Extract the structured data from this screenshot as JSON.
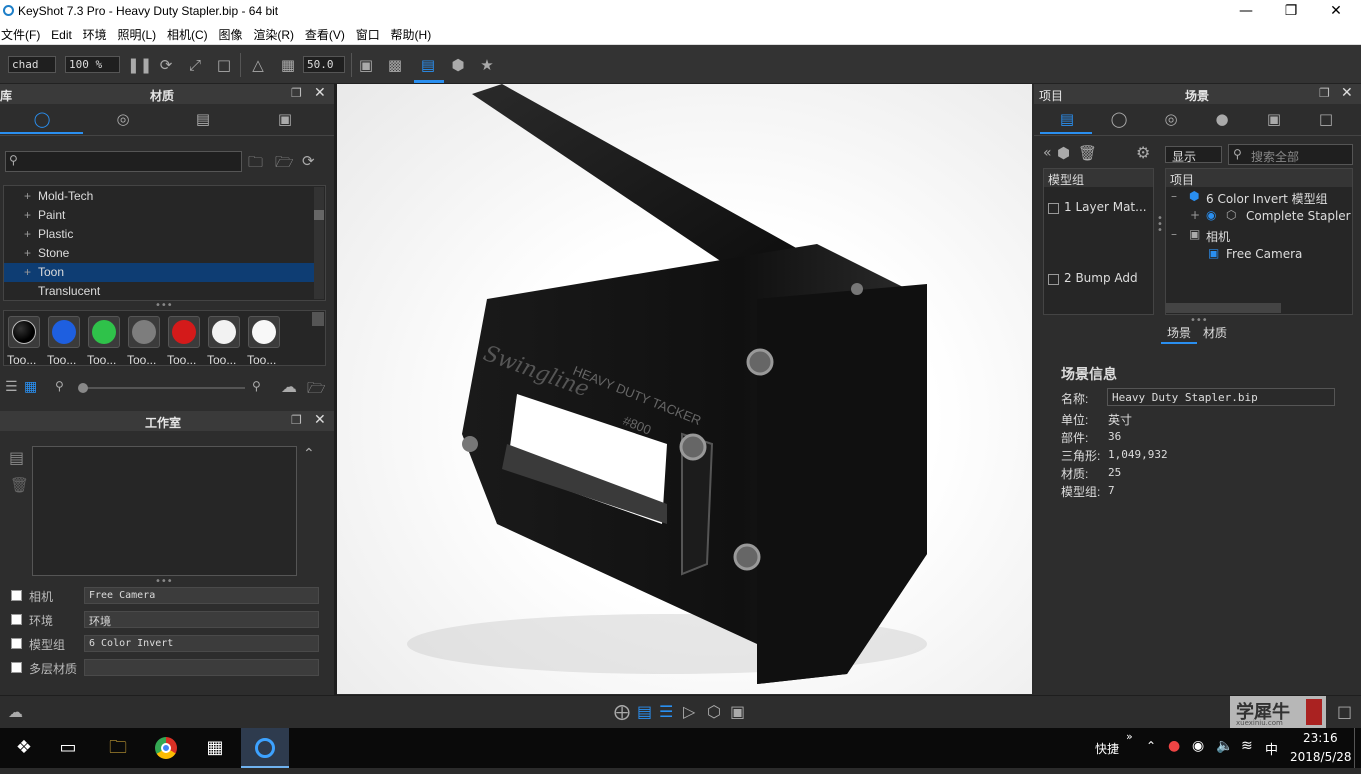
{
  "window": {
    "title": "KeyShot 7.3 Pro  - Heavy Duty Stapler.bip  - 64 bit"
  },
  "menu": [
    "文件(F)",
    "Edit",
    "环境",
    "照明(L)",
    "相机(C)",
    "图像",
    "渲染(R)",
    "查看(V)",
    "窗口",
    "帮助(H)"
  ],
  "toolbar": {
    "cpu_preset": "chad",
    "zoom": "100 %",
    "fov_value": "50.0"
  },
  "library": {
    "title_left": "库",
    "title": "材质",
    "items": [
      {
        "label": "Mold-Tech",
        "expandable": true
      },
      {
        "label": "Paint",
        "expandable": true
      },
      {
        "label": "Plastic",
        "expandable": true
      },
      {
        "label": "Stone",
        "expandable": true
      },
      {
        "label": "Toon",
        "expandable": true,
        "selected": true
      },
      {
        "label": "Translucent",
        "expandable": false
      }
    ],
    "swatches": [
      {
        "label": "Too...",
        "color": "#000000"
      },
      {
        "label": "Too...",
        "color": "#1e5fe0"
      },
      {
        "label": "Too...",
        "color": "#2fc24a"
      },
      {
        "label": "Too...",
        "color": "#7d7d7d"
      },
      {
        "label": "Too...",
        "color": "#d41a1a"
      },
      {
        "label": "Too...",
        "color": "#f2f2f2"
      },
      {
        "label": "Too...",
        "color": "#f8f8f8"
      }
    ]
  },
  "studio": {
    "title": "工作室",
    "rows": [
      {
        "label": "相机",
        "value": "Free Camera"
      },
      {
        "label": "环境",
        "value": "环境"
      },
      {
        "label": "模型组",
        "value": "6 Color Invert"
      },
      {
        "label": "多层材质",
        "value": ""
      }
    ]
  },
  "scene_panel": {
    "title_left": "项目",
    "title": "场景",
    "display_label": "显示",
    "search_placeholder": "搜索全部",
    "model_group_header": "模型组",
    "items_header": "项目",
    "model_groups": [
      "1 Layer Mat...",
      "2 Bump Add"
    ],
    "tree": [
      {
        "label": "6 Color Invert 模型组",
        "level": 0
      },
      {
        "label": "Complete Stapler",
        "level": 1
      },
      {
        "label": "相机",
        "level": 0
      },
      {
        "label": "Free Camera",
        "level": 1
      }
    ],
    "subtabs": [
      "场景",
      "材质"
    ],
    "info": {
      "heading": "场景信息",
      "name_label": "名称:",
      "name_value": "Heavy Duty Stapler.bip",
      "unit_label": "单位:",
      "unit_value": "英寸",
      "parts_label": "部件:",
      "parts_value": "36",
      "tris_label": "三角形:",
      "tris_value": "1,049,932",
      "mats_label": "材质:",
      "mats_value": "25",
      "groups_label": "模型组:",
      "groups_value": "7"
    }
  },
  "viewport": {
    "brand_text": "Swingline",
    "product_text": "HEAVY DUTY TACKER",
    "model_text": "#800"
  },
  "taskbar": {
    "quick_label": "快捷",
    "ime": "中",
    "time": "23:16",
    "date": "2018/5/28",
    "watermark": "学犀牛",
    "watermark_sub": "xuexiniu.com"
  }
}
